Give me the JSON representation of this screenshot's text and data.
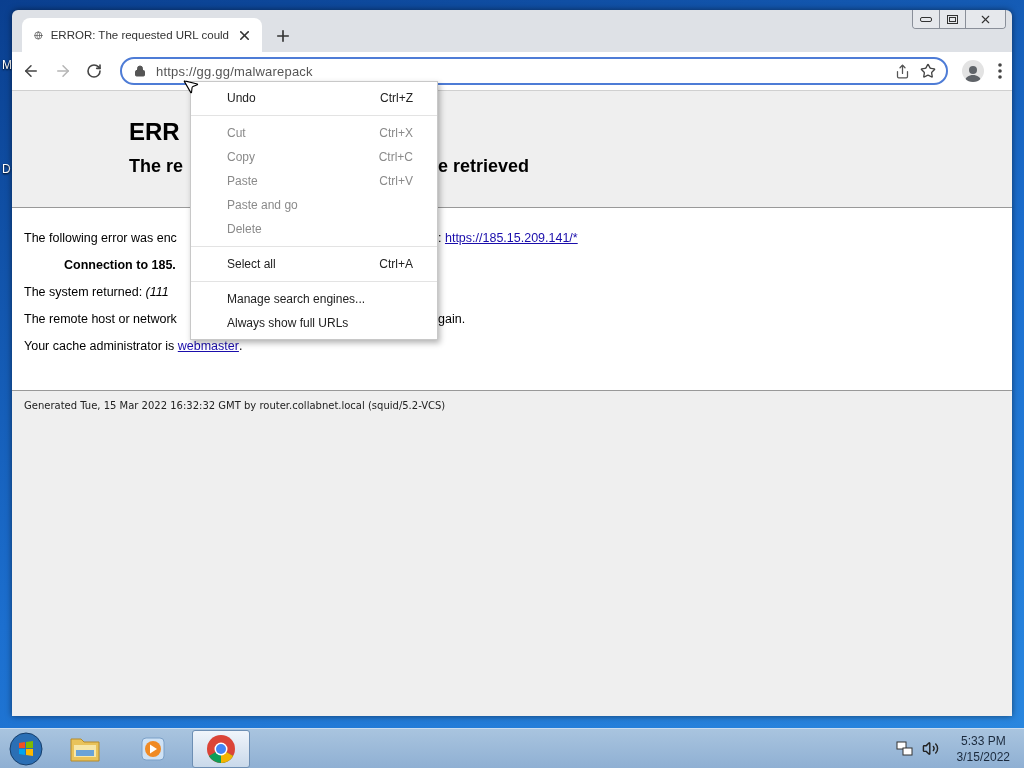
{
  "desktop": {
    "icon_labels": [
      "M",
      "D"
    ]
  },
  "window": {
    "tab": {
      "title": "ERROR: The requested URL could",
      "selected": true
    }
  },
  "toolbar": {
    "forward_disabled": true,
    "url": "https://gg.gg/malwarepack"
  },
  "page": {
    "heading": "ERR",
    "subheading": {
      "left": "The re",
      "right": "e retrieved"
    },
    "lines": [
      {
        "kind": "text",
        "left": "The following error was enc",
        "right": ": ",
        "link": "https://185.15.209.141/*"
      },
      {
        "kind": "bold",
        "left": "Connection to 185."
      },
      {
        "kind": "text",
        "left": "The system returned: *(111*"
      },
      {
        "kind": "text",
        "left": "The remote host or network",
        "right": "gain."
      },
      {
        "kind": "admin",
        "left": "Your cache administrator is ",
        "link": "webmaster",
        "after": "."
      }
    ],
    "footer": "Generated Tue, 15 Mar 2022 16:32:32 GMT by router.collabnet.local (squid/5.2-VCS)"
  },
  "context_menu": [
    {
      "kind": "item",
      "label": "Undo",
      "shortcut": "Ctrl+Z",
      "disabled": false
    },
    {
      "kind": "separator"
    },
    {
      "kind": "item",
      "label": "Cut",
      "shortcut": "Ctrl+X",
      "disabled": true
    },
    {
      "kind": "item",
      "label": "Copy",
      "shortcut": "Ctrl+C",
      "disabled": true
    },
    {
      "kind": "item",
      "label": "Paste",
      "shortcut": "Ctrl+V",
      "disabled": true
    },
    {
      "kind": "item",
      "label": "Paste and go",
      "disabled": true
    },
    {
      "kind": "item",
      "label": "Delete",
      "disabled": true
    },
    {
      "kind": "separator"
    },
    {
      "kind": "item",
      "label": "Select all",
      "shortcut": "Ctrl+A",
      "disabled": false
    },
    {
      "kind": "separator"
    },
    {
      "kind": "item",
      "label": "Manage search engines...",
      "disabled": false
    },
    {
      "kind": "item",
      "label": "Always show full URLs",
      "disabled": false
    }
  ],
  "taskbar": {
    "apps": [
      {
        "kind": "folder",
        "selected": false
      },
      {
        "kind": "media",
        "selected": false
      },
      {
        "kind": "chrome",
        "selected": true
      }
    ],
    "time": "5:33 PM",
    "date": "3/15/2022"
  }
}
